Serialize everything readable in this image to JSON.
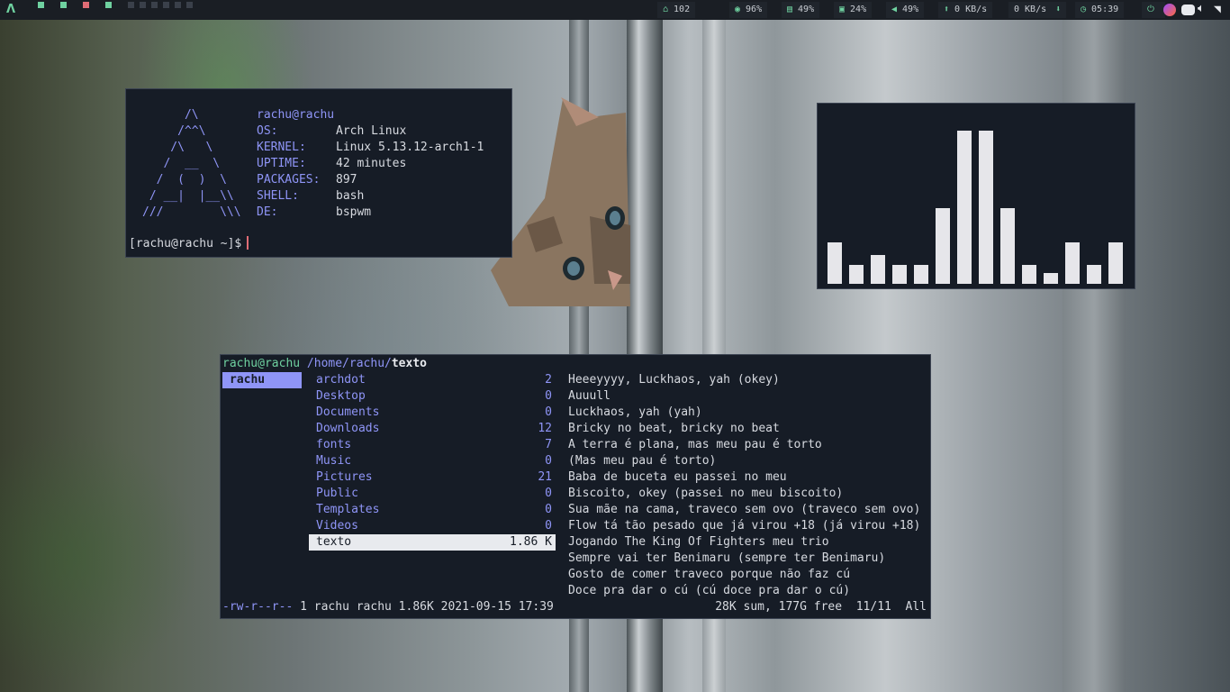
{
  "topbar": {
    "logo": "Λ",
    "workspaces": [
      {
        "color": "#6fd1a0"
      },
      {
        "color": "#6fd1a0"
      },
      {
        "color": "#e06c75"
      },
      {
        "color": "#6fd1a0"
      },
      {
        "color": "#3a404a"
      },
      {
        "color": "#3a404a"
      },
      {
        "color": "#3a404a"
      },
      {
        "color": "#3a404a"
      },
      {
        "color": "#3a404a"
      },
      {
        "color": "#3a404a"
      }
    ],
    "updates": "102",
    "cpu": "96%",
    "mem": "49%",
    "disk": "24%",
    "volume": "49%",
    "net_up": "0 KB/s",
    "net_down": "0 KB/s",
    "clock": "05:39",
    "icons": [
      "package-icon",
      "cpu-icon",
      "memory-icon",
      "disk-icon",
      "volume-icon",
      "upload-icon",
      "download-icon",
      "clock-icon",
      "power-icon",
      "firefox-icon",
      "discord-icon",
      "speaker-icon",
      "wifi-icon"
    ]
  },
  "neofetch": {
    "ascii": "      /\\\n     /^^\\\n    /\\   \\\n   /  __  \\\n  /  (  )  \\\n / __|  |__\\\\\n///        \\\\\\",
    "host": "rachu@rachu",
    "rows": [
      {
        "key": "OS:",
        "value": "Arch Linux"
      },
      {
        "key": "KERNEL:",
        "value": "Linux 5.13.12-arch1-1"
      },
      {
        "key": "UPTIME:",
        "value": "42 minutes"
      },
      {
        "key": "PACKAGES:",
        "value": "897"
      },
      {
        "key": "SHELL:",
        "value": "bash"
      },
      {
        "key": "DE:",
        "value": "bspwm"
      }
    ],
    "prompt": "[rachu@rachu ~]$"
  },
  "visualizer": {
    "levels": [
      0.26,
      0.12,
      0.18,
      0.12,
      0.12,
      0.48,
      0.97,
      0.97,
      0.48,
      0.12,
      0.07,
      0.26,
      0.12,
      0.26
    ]
  },
  "ranger": {
    "user": "rachu@rachu",
    "path": "/home/rachu/",
    "current": "texto",
    "parent": [
      "rachu"
    ],
    "entries": [
      {
        "name": "archdot",
        "count": "2"
      },
      {
        "name": "Desktop",
        "count": "0"
      },
      {
        "name": "Documents",
        "count": "0"
      },
      {
        "name": "Downloads",
        "count": "12"
      },
      {
        "name": "fonts",
        "count": "7"
      },
      {
        "name": "Music",
        "count": "0"
      },
      {
        "name": "Pictures",
        "count": "21"
      },
      {
        "name": "Public",
        "count": "0"
      },
      {
        "name": "Templates",
        "count": "0"
      },
      {
        "name": "Videos",
        "count": "0"
      },
      {
        "name": "texto",
        "count": "1.86 K",
        "selected": true
      }
    ],
    "preview": [
      "Heeeyyyy, Luckhaos, yah (okey)",
      "Auuull",
      "Luckhaos, yah (yah)",
      "Bricky no beat, bricky no beat",
      "A terra é plana, mas meu pau é torto",
      "(Mas meu pau é torto)",
      "Baba de buceta eu passei no meu",
      "Biscoito, okey (passei no meu biscoito)",
      "Sua mãe na cama, traveco sem ovo (traveco sem ovo)",
      "Flow tá tão pesado que já virou +18 (já virou +18)",
      "Jogando The King Of Fighters meu trio",
      "Sempre vai ter Benimaru (sempre ter Benimaru)",
      "Gosto de comer traveco porque não faz cú",
      "Doce pra dar o cú (cú doce pra dar o cú)"
    ],
    "status": {
      "perms": "-rw-r--r--",
      "meta": " 1 rachu rachu 1.86K 2021-09-15 17:39",
      "right": "28K sum, 177G free  11/11  All"
    }
  }
}
